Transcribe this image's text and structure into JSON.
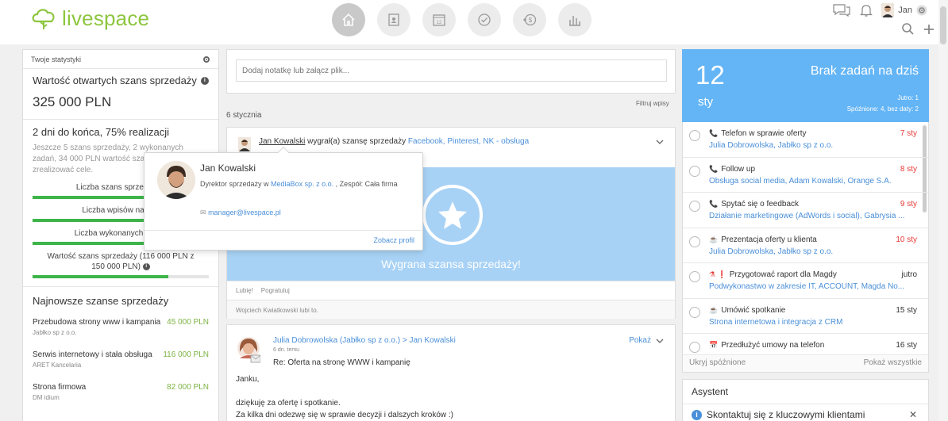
{
  "brand": {
    "name": "livespace",
    "color": "#8dc63f"
  },
  "header": {
    "nav": [
      "home-icon",
      "contacts-icon",
      "calendar-icon",
      "tasks-icon",
      "sales-icon",
      "reports-icon"
    ],
    "user": "Jan"
  },
  "stats": {
    "header": "Twoje statystyki",
    "open_title": "Wartość otwartych szans sprzedaży",
    "open_value": "325 000 PLN",
    "days_left": "2 dni do końca, 75% realizacji",
    "desc": "Jeszcze 5 szans sprzedaży, 2 wykonanych zadań, 34 000 PLN wartość szans sprzedaży, aby zrealizować cele.",
    "bars": [
      {
        "label": "Liczba szans sprzedaży (",
        "progress": 0.72
      },
      {
        "label": "Liczba wpisów na tabl",
        "progress": 0.8
      },
      {
        "label": "Liczba wykonanych zadań",
        "progress": 0.75
      },
      {
        "label": "Wartość szans sprzedaży (116 000 PLN z 150 000 PLN)",
        "progress": 0.77
      }
    ]
  },
  "newest": {
    "title": "Najnowsze szanse sprzedaży",
    "items": [
      {
        "name": "Przebudowa strony www i kampania",
        "sub": "Jabłko sp z o.o.",
        "value": "45 000 PLN"
      },
      {
        "name": "Serwis internetowy i stała obsługa",
        "sub": "ARET Kancelaria",
        "value": "116 000 PLN"
      },
      {
        "name": "Strona firmowa",
        "sub": "DM idium",
        "value": "82 000 PLN"
      }
    ]
  },
  "feed": {
    "note_placeholder": "Dodaj notatkę lub załącz plik...",
    "filter": "Filtruj wpisy",
    "date": "6 stycznia",
    "card1": {
      "author": "Jan Kowalski",
      "verb": "wygrał(a) szansę sprzedaży",
      "deal": "Facebook, Pinterest, NK - obsługa",
      "win_text": "Wygrana szansa sprzedaży!",
      "actions": [
        "Lubię!",
        "Pogratuluj"
      ],
      "likes": "Wojciech Kwiatkowski lubi to."
    },
    "card2": {
      "from": "Julia Dobrowolska (Jabłko sp z o.o.) > Jan Kowalski",
      "time": "6 dn. temu",
      "subject": "Re: Oferta na stronę WWW i kampanię",
      "show": "Pokaż",
      "greeting": "Janku,",
      "line1": "dziękuję za ofertę i spotkanie.",
      "line2": "Za kilka dni odezwę się w sprawie decyzji i dalszych kroków :)"
    }
  },
  "popover": {
    "name": "Jan Kowalski",
    "role_prefix": "Dyrektor sprzedaży w",
    "company": "MediaBox sp. z o.o.",
    "role_suffix": ", Zespół: Cała firma",
    "email": "manager@livespace.pl",
    "profile": "Zobacz profil"
  },
  "today": {
    "day": "12",
    "month": "sty",
    "no_tasks": "Brak zadań na dziś",
    "tomorrow": "Jutro: 1",
    "late": "Spóźnione: 4, bez daty: 2"
  },
  "tasks": [
    {
      "icon": "phone-icon",
      "glyph": "📞",
      "title": "Telefon w sprawie oferty",
      "sub": "Julia Dobrowolska, Jabłko sp z o.o.",
      "due": "7 sty",
      "late": true
    },
    {
      "icon": "phone-icon",
      "glyph": "📞",
      "title": "Follow up",
      "sub": "Obsługa social media, Adam Kowalski, Orange S.A.",
      "due": "8 sty",
      "late": true
    },
    {
      "icon": "phone-icon",
      "glyph": "📞",
      "title": "Spytać się o feedback",
      "sub": "Działanie marketingowe (AdWords i social), Gabrysia ...",
      "due": "9 sty",
      "late": true
    },
    {
      "icon": "coffee-icon",
      "glyph": "☕",
      "title": "Prezentacja oferty u klienta",
      "sub": "Julia Dobrowolska, Jabłko sp z o.o.",
      "due": "10 sty",
      "late": true
    },
    {
      "icon": "flask-icon",
      "glyph": "⚗ ❗",
      "title": "Przygotować raport dla Magdy",
      "sub": "Podwykonastwo w zakresie IT, ACCOUNT, Magda No...",
      "due": "jutro",
      "late": false
    },
    {
      "icon": "coffee-icon",
      "glyph": "☕",
      "title": "Umówić spotkanie",
      "sub": "Strona internetowa i integracja z CRM",
      "due": "15 sty",
      "late": false
    },
    {
      "icon": "calendar-icon",
      "glyph": "📅",
      "title": "Przedłużyć umowy na telefon",
      "sub": "",
      "due": "16 sty",
      "late": false
    }
  ],
  "tasks_footer": {
    "hide": "Ukryj spóźnione",
    "show_all": "Pokaż wszystkie"
  },
  "assistant": {
    "title": "Asystent",
    "tip": "Skontaktuj się z kluczowymi klientami"
  }
}
